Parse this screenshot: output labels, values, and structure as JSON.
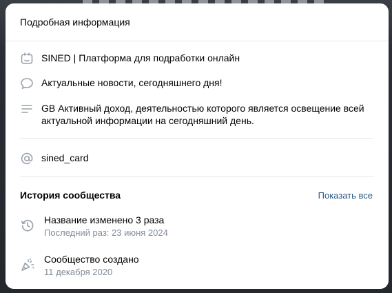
{
  "modal": {
    "title": "Подробная информация"
  },
  "info": {
    "name": "SINED | Платформа для подработки онлайн",
    "status": "Актуальные новости, сегодняшнего дня!",
    "description_line1": "GB Активный доход, деятельностью которого является освещение всей",
    "description_line2": "актуальной информации на сегодняшний день.",
    "screen_name": "sined_card"
  },
  "history": {
    "title": "История сообщества",
    "show_all": "Показать все",
    "items": [
      {
        "main": "Название изменено 3 раза",
        "sub": "Последний раз: 23 июня 2024",
        "icon": "history-icon"
      },
      {
        "main": "Сообщество создано",
        "sub": "11 декабря 2020",
        "icon": "party-popper-icon"
      }
    ]
  },
  "colors": {
    "accent": "#2a5885",
    "icon": "#99a2ad",
    "secondary_text": "#818c99",
    "divider": "#e7e8ec"
  }
}
